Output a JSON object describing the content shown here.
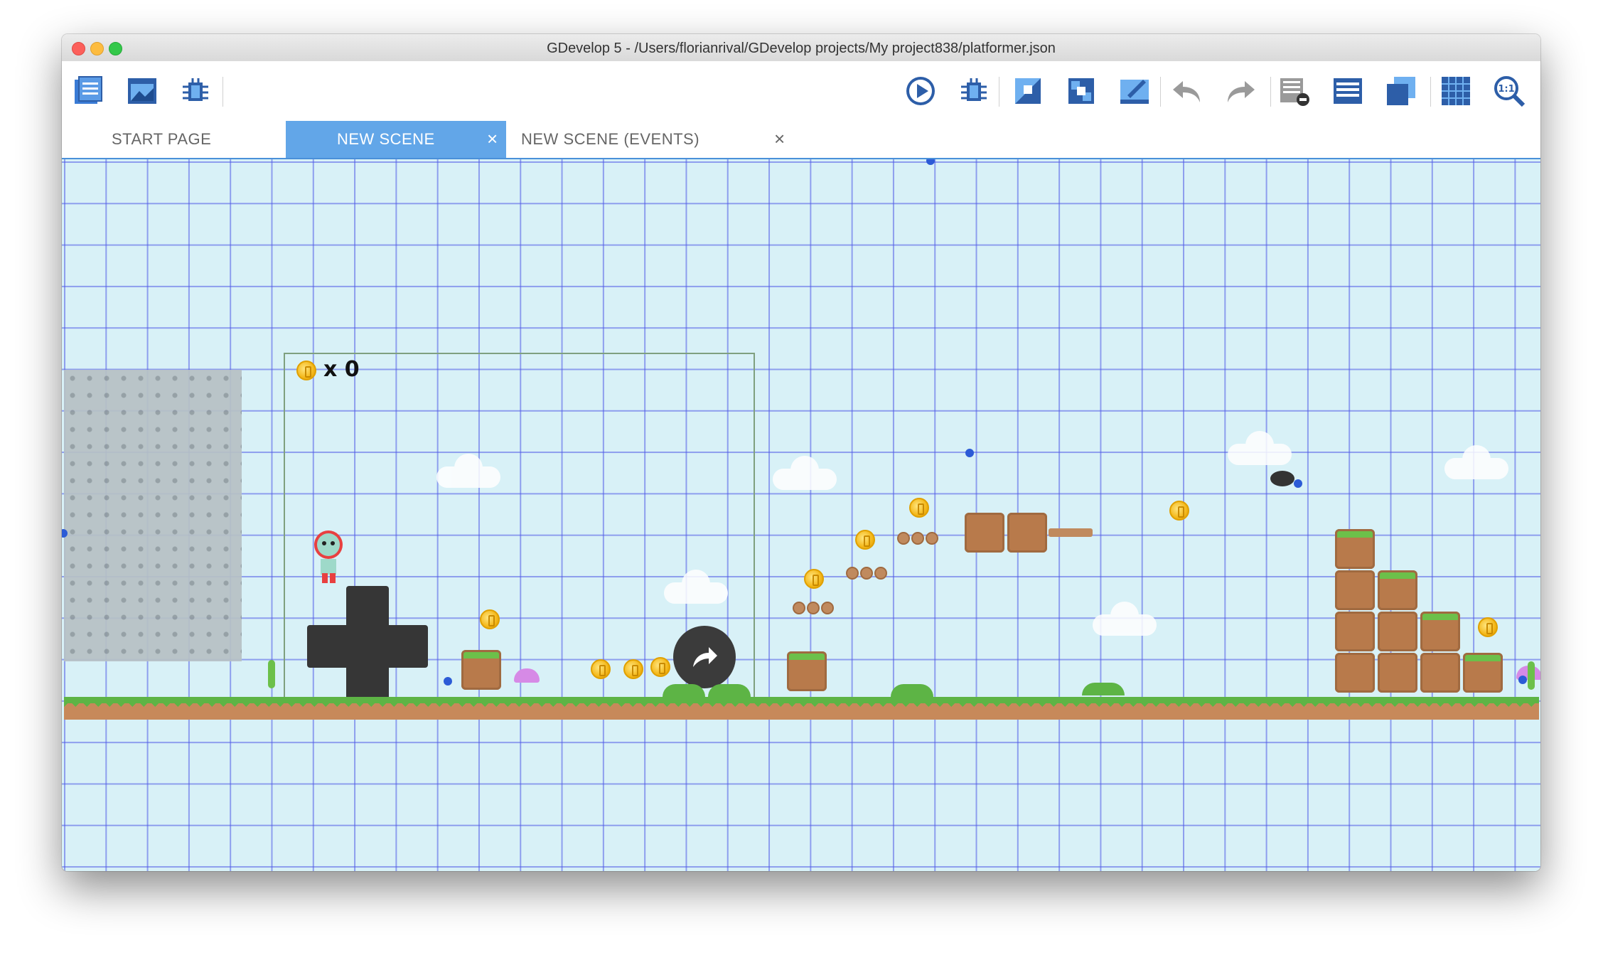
{
  "window": {
    "title": "GDevelop 5 - /Users/florianrival/GDevelop projects/My project838/platformer.json"
  },
  "toolbar": {
    "left": [
      "project-manager-icon",
      "scene-icon",
      "debugger-icon"
    ],
    "right": [
      "preview-icon",
      "debug-icon",
      "objects-icon",
      "object-groups-icon",
      "properties-icon",
      "undo-icon",
      "redo-icon",
      "instances-list-icon",
      "layers-list-icon",
      "layers-icon",
      "grid-icon",
      "zoom-reset-icon"
    ]
  },
  "tabs": [
    {
      "label": "START PAGE",
      "active": false
    },
    {
      "label": "NEW SCENE",
      "active": true,
      "close": "×"
    },
    {
      "label": "NEW SCENE (EVENTS)",
      "active": false,
      "close": "×"
    }
  ],
  "scene": {
    "coin_counter": "x 0"
  },
  "colors": {
    "active_tab": "#62a6e8",
    "canvas_bg": "#d8f1f7",
    "grid": "#5a5ae6"
  }
}
